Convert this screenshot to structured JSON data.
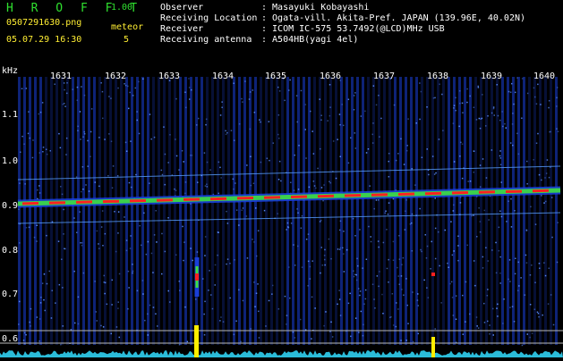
{
  "header": {
    "app_title": "H R O F F T",
    "version": "1.00",
    "filename": "0507291630.png",
    "datetime": "05.07.29 16:30",
    "meteor_label": "meteor",
    "meteor_count": "5",
    "info": [
      {
        "label": "Observer",
        "value": ": Masayuki Kobayashi"
      },
      {
        "label": "Receiving Location",
        "value": ": Ogata-vill. Akita-Pref. JAPAN (139.96E, 40.02N)"
      },
      {
        "label": "Receiver",
        "value": ": ICOM IC-575 53.7492(@LCD)MHz USB"
      },
      {
        "label": "Receiving antenna",
        "value": ": A504HB(yagi 4el)"
      }
    ]
  },
  "spectrogram": {
    "y_unit": "kHz",
    "y_ticks": [
      "1.1",
      "1.0",
      "0.9",
      "0.8",
      "0.7",
      "0.6"
    ],
    "minute_ticks": [
      "1631",
      "1632",
      "1633",
      "1634",
      "1635",
      "1636",
      "1637",
      "1638",
      "1639",
      "1640"
    ],
    "colors": {
      "background": "#000000",
      "noise": "#1a3fd8",
      "carrier_core": "#ff2020",
      "carrier_mid": "#40e040",
      "text_header": "#ffee33",
      "app_green": "#2fe02f",
      "signal_trace": "#33ddff",
      "meteor_spike": "#ffee00"
    }
  }
}
